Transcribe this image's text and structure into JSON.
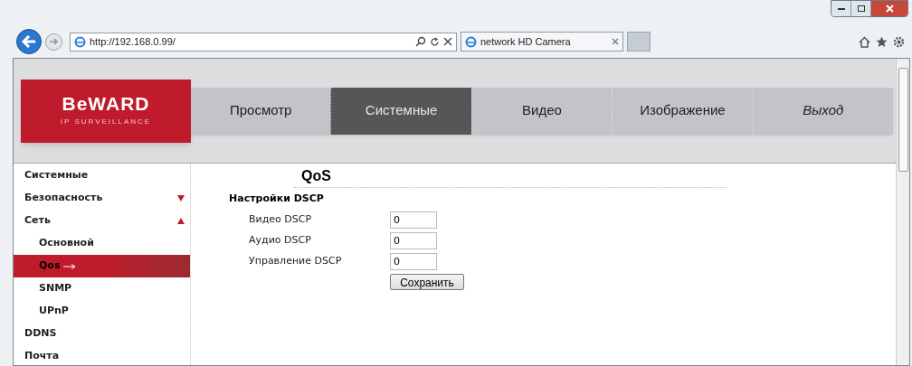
{
  "browser": {
    "address": "http://192.168.0.99/",
    "tab": {
      "title": "network HD Camera",
      "selected": true
    }
  },
  "logo": {
    "name": "BeWARD",
    "tagline": "IP SURVEILLANCE"
  },
  "nav": [
    {
      "label": "Просмотр",
      "selected": false,
      "kind": "page"
    },
    {
      "label": "Системные",
      "selected": true,
      "kind": "page"
    },
    {
      "label": "Видео",
      "selected": false,
      "kind": "page"
    },
    {
      "label": "Изображение",
      "selected": false,
      "kind": "page"
    },
    {
      "label": "Выход",
      "selected": false,
      "kind": "logout"
    }
  ],
  "sidebar": {
    "items": [
      {
        "label": "Системные",
        "selected": false
      },
      {
        "label": "Безопасность",
        "selected": false,
        "expanded": false
      },
      {
        "label": "Сеть",
        "selected": false,
        "expanded": true,
        "children": [
          {
            "label": "Основной",
            "selected": false
          },
          {
            "label": "Qos",
            "selected": true
          },
          {
            "label": "SNMP",
            "selected": false
          },
          {
            "label": "UPnP",
            "selected": false
          }
        ]
      },
      {
        "label": "DDNS",
        "selected": false
      },
      {
        "label": "Почта",
        "selected": false
      }
    ]
  },
  "content": {
    "title": "QoS",
    "section": "Настройки DSCP",
    "fields": [
      {
        "label": "Видео DSCP",
        "value": "0"
      },
      {
        "label": "Аудио DSCP",
        "value": "0"
      },
      {
        "label": "Управление DSCP",
        "value": "0"
      }
    ],
    "save_button": "Сохранить"
  }
}
